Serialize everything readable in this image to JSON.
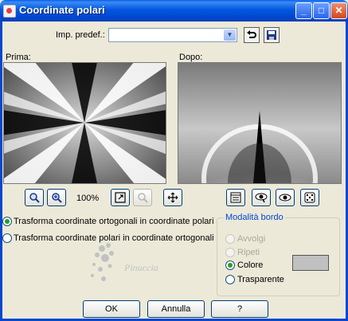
{
  "window": {
    "title": "Coordinate polari"
  },
  "preset": {
    "label": "Imp. predef.:",
    "value": ""
  },
  "previews": {
    "before_label": "Prima:",
    "after_label": "Dopo:"
  },
  "zoom": {
    "level": "100%"
  },
  "options": [
    {
      "label": "Trasforma coordinate ortogonali in coordinate polari",
      "selected": true
    },
    {
      "label": "Trasforma coordinate polari in coordinate ortogonali",
      "selected": false
    }
  ],
  "border_mode": {
    "title": "Modalità bordo",
    "options": [
      {
        "label": "Avvolgi",
        "enabled": false,
        "selected": false
      },
      {
        "label": "Ripeti",
        "enabled": false,
        "selected": false
      },
      {
        "label": "Colore",
        "enabled": true,
        "selected": true
      },
      {
        "label": "Trasparente",
        "enabled": true,
        "selected": false
      }
    ],
    "color": "#c0c0c0"
  },
  "buttons": {
    "ok": "OK",
    "cancel": "Annulla",
    "help": "?"
  },
  "watermark": "Pinuccia",
  "colors": {
    "titlebar": "#0047d0",
    "dialog_bg": "#ece9d8",
    "group_title": "#0046d5",
    "radio_dot": "#21a121"
  }
}
